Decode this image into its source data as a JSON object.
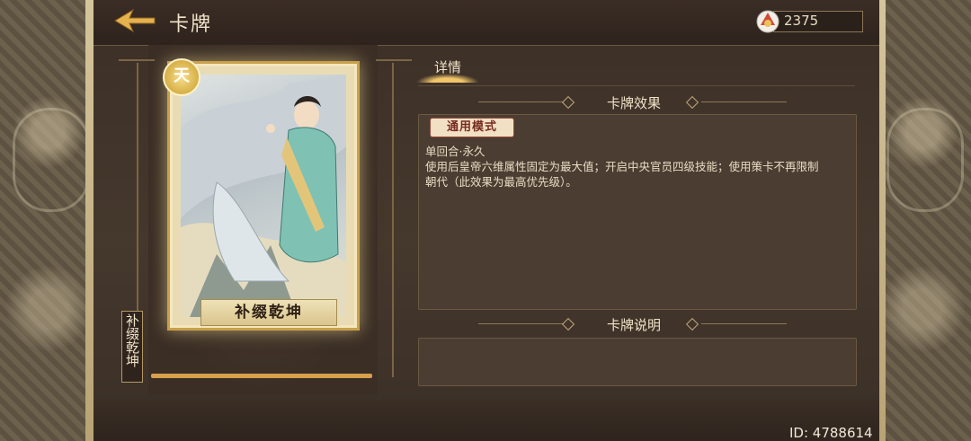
{
  "header": {
    "title": "卡牌",
    "currency": {
      "icon": "feather-token-icon",
      "value": "2375"
    }
  },
  "card": {
    "name": "补缀乾坤",
    "badge": "天",
    "vertical_label": "补缀乾坤",
    "progress": 1.0
  },
  "tabs": [
    {
      "label": "详情",
      "active": true
    }
  ],
  "sections": {
    "effect_title": "卡牌效果",
    "mode_tag": "通用模式",
    "effect_lines": [
      "单回合·永久",
      "使用后皇帝六维属性固定为最大值；开启中央官员四级技能；使用策卡不再限制",
      "朝代（此效果为最高优先级）。"
    ],
    "desc_title": "卡牌说明"
  },
  "footer": {
    "player_id": "ID: 4788614"
  },
  "colors": {
    "accent": "#d8a04c",
    "text": "#efe3c8",
    "panel": "#3c3027"
  }
}
